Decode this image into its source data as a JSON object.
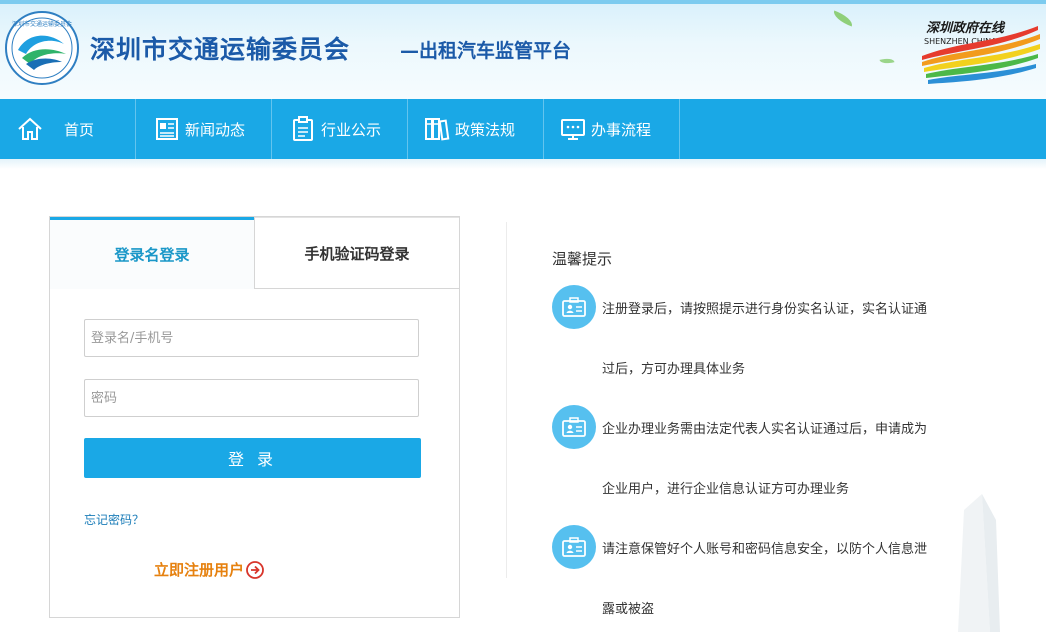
{
  "header": {
    "logo_text": "深圳市交通运输委员会",
    "title": "深圳市交通运输委员会",
    "subtitle": "—出租汽车监管平台",
    "brand_logo_cn": "深圳政府在线",
    "brand_logo_en": "SHENZHEN CHINA"
  },
  "nav": {
    "items": [
      {
        "label": "首页",
        "icon": "home-icon"
      },
      {
        "label": "新闻动态",
        "icon": "news-icon"
      },
      {
        "label": "行业公示",
        "icon": "clipboard-icon"
      },
      {
        "label": "政策法规",
        "icon": "books-icon"
      },
      {
        "label": "办事流程",
        "icon": "monitor-icon"
      }
    ]
  },
  "login": {
    "tabs": [
      {
        "label": "登录名登录",
        "active": true
      },
      {
        "label": "手机验证码登录",
        "active": false
      }
    ],
    "username_placeholder": "登录名/手机号",
    "password_placeholder": "密码",
    "login_button": "登 录",
    "forgot_password": "忘记密码？",
    "register": "立即注册用户"
  },
  "tips": {
    "title": "温馨提示",
    "items": [
      {
        "lines": [
          "注册登录后，请按照提示进行身份实名认证，实名认证通",
          "过后，方可办理具体业务"
        ],
        "icon": "id-card-icon"
      },
      {
        "lines": [
          "企业办理业务需由法定代表人实名认证通过后，申请成为",
          "企业用户，进行企业信息认证方可办理业务"
        ],
        "icon": "id-card-icon"
      },
      {
        "lines": [
          "请注意保管好个人账号和密码信息安全，以防个人信息泄",
          "露或被盗"
        ],
        "icon": "id-card-icon"
      }
    ]
  },
  "colors": {
    "nav_bg": "#1aa8e6",
    "title_blue": "#1b5aa8",
    "register_orange": "#e6810f",
    "tip_icon_bg": "#56c0ef"
  }
}
